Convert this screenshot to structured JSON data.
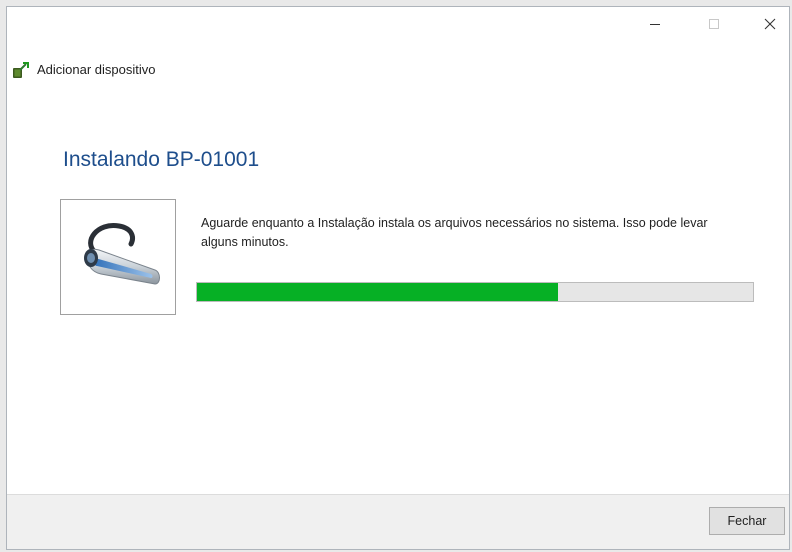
{
  "window": {
    "app_title": "Adicionar dispositivo",
    "controls": {
      "minimize_icon": "minimize-icon",
      "maximize_icon": "maximize-icon",
      "close_icon": "close-icon"
    }
  },
  "main": {
    "heading": "Instalando BP-01001",
    "device_icon": "headset-icon",
    "description": "Aguarde enquanto a Instalação instala os arquivos necessários no sistema. Isso pode levar alguns minutos.",
    "progress": {
      "fraction": 0.65,
      "color": "#06b025"
    }
  },
  "footer": {
    "close_label": "Fechar"
  },
  "colors": {
    "heading": "#1e4e8c",
    "progress_fill": "#06b025",
    "progress_track": "#e6e6e6"
  }
}
